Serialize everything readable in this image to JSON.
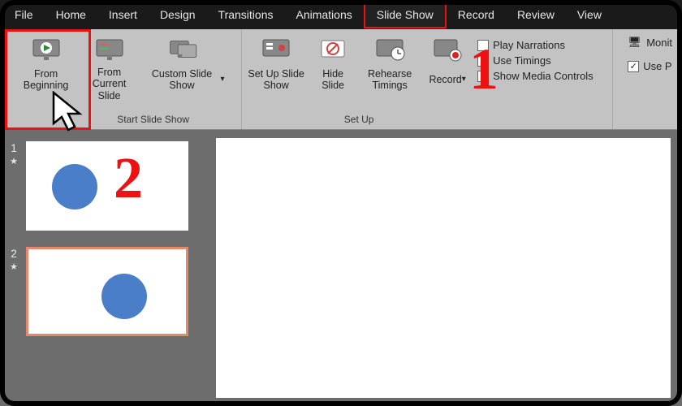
{
  "menubar": {
    "tabs": [
      "File",
      "Home",
      "Insert",
      "Design",
      "Transitions",
      "Animations",
      "Slide Show",
      "Record",
      "Review",
      "View"
    ],
    "active_index": 6
  },
  "ribbon": {
    "group_start": {
      "label": "Start Slide Show",
      "from_beginning": "From Beginning",
      "from_current": "From Current Slide",
      "custom": "Custom Slide Show"
    },
    "group_setup": {
      "label": "Set Up",
      "setup": "Set Up Slide Show",
      "hide": "Hide Slide",
      "rehearse": "Rehearse Timings",
      "record": "Record",
      "play_narrations": "Play Narrations",
      "use_timings": "Use Timings",
      "show_media": "Show Media Controls"
    },
    "group_monitors": {
      "monitor": "Monit",
      "use_presenter": "Use P"
    }
  },
  "thumbs": {
    "items": [
      {
        "n": "1"
      },
      {
        "n": "2"
      }
    ]
  },
  "annotations": {
    "one": "1",
    "two": "2"
  }
}
